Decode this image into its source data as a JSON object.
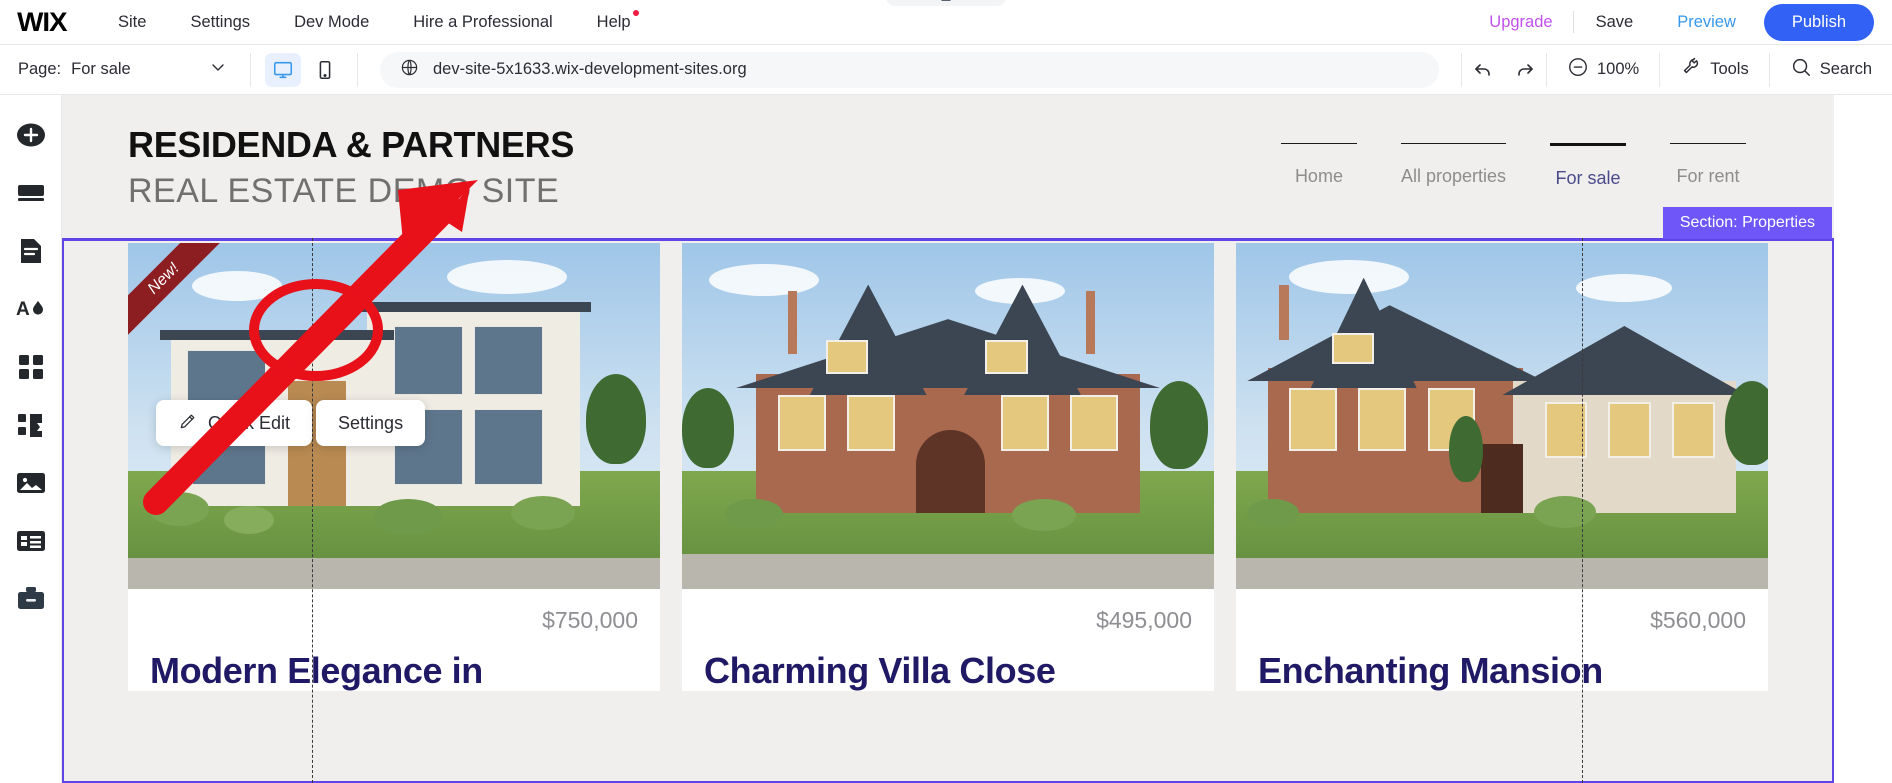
{
  "topbar": {
    "logo": "WIX",
    "menu": [
      {
        "label": "Site"
      },
      {
        "label": "Settings"
      },
      {
        "label": "Dev Mode"
      },
      {
        "label": "Hire a Professional"
      },
      {
        "label": "Help"
      }
    ],
    "upgrade_label": "Upgrade",
    "save_label": "Save",
    "preview_label": "Preview",
    "publish_label": "Publish"
  },
  "toolbar": {
    "page_label": "Page:",
    "page_value": "For sale",
    "url": "dev-site-5x1633.wix-development-sites.org",
    "zoom_level": "100%",
    "tools_label": "Tools",
    "search_label": "Search"
  },
  "sidebar": {
    "items": [
      {
        "name": "add-elements",
        "icon": "plus-circle-icon"
      },
      {
        "name": "sections",
        "icon": "sections-icon"
      },
      {
        "name": "pages",
        "icon": "page-icon"
      },
      {
        "name": "site-design",
        "icon": "theme-icon"
      },
      {
        "name": "apps",
        "icon": "grid-icon"
      },
      {
        "name": "integrations",
        "icon": "puzzle-icon"
      },
      {
        "name": "media",
        "icon": "image-icon"
      },
      {
        "name": "cms",
        "icon": "table-icon"
      },
      {
        "name": "business-tools",
        "icon": "briefcase-icon"
      }
    ]
  },
  "floating_toolbar": {
    "quick_edit_label": "Quick Edit",
    "settings_label": "Settings"
  },
  "selection": {
    "badge": "Section: Properties",
    "accent_color": "#6e56f8"
  },
  "site": {
    "brand_title": "RESIDENDA & PARTNERS",
    "brand_subtitle": "REAL ESTATE DEMO SITE",
    "nav": [
      {
        "label": "Home",
        "active": false
      },
      {
        "label": "All properties",
        "active": false
      },
      {
        "label": "For sale",
        "active": true
      },
      {
        "label": "For rent",
        "active": false
      }
    ],
    "cards": [
      {
        "price": "$750,000",
        "title": "Modern Elegance in",
        "ribbon": "New!"
      },
      {
        "price": "$495,000",
        "title": "Charming Villa Close",
        "ribbon": ""
      },
      {
        "price": "$560,000",
        "title": "Enchanting Mansion",
        "ribbon": ""
      }
    ]
  },
  "colors": {
    "publish_blue": "#3161f5",
    "upgrade_purple": "#c150ec",
    "preview_blue": "#3899ec",
    "title_navy": "#201a66",
    "annotation_red": "#e8111a"
  }
}
